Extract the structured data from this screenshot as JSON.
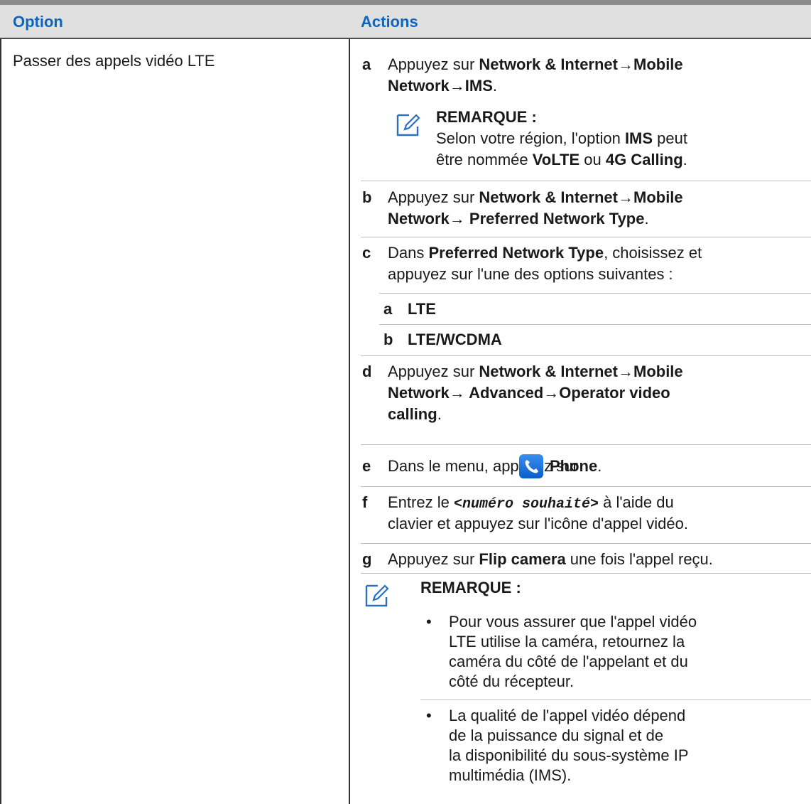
{
  "header": {
    "col_option": "Option",
    "col_actions": "Actions"
  },
  "row": {
    "option": "Passer des appels vidéo LTE",
    "steps": {
      "a": {
        "letter": "a",
        "prefix": "Appuyez sur ",
        "path_1": "Network & Internet→Mobile",
        "path_2": "Network→IMS",
        "end": "."
      },
      "note1": {
        "title": "REMARQUE :",
        "line1_text": "Selon votre région, l'option ",
        "line1_bold": "IMS",
        "line1_end": " peut",
        "line2_pre": "être nommée ",
        "line2_b1": "VoLTE",
        "line2_mid": " ou ",
        "line2_b2": "4G Calling",
        "line2_end": "."
      },
      "b": {
        "letter": "b",
        "prefix": "Appuyez sur ",
        "path_1": "Network & Internet→Mobile",
        "path_2": "Network→ Preferred Network Type",
        "end": "."
      },
      "c": {
        "letter": "c",
        "line1_pre": "Dans ",
        "line1_bold": "Preferred Network Type",
        "line1_end": ", choisissez et",
        "line2": "appuyez sur l'une des options suivantes :",
        "sub": [
          {
            "letter": "a",
            "label": "LTE"
          },
          {
            "letter": "b",
            "label": "LTE/WCDMA"
          }
        ]
      },
      "d": {
        "letter": "d",
        "prefix": "Appuyez sur ",
        "path_1": "Network & Internet→Mobile",
        "path_2": "Network→ Advanced→Operator video",
        "path_3": "calling",
        "end": "."
      },
      "e": {
        "letter": "e",
        "text": "Dans le menu, appuyez sur ",
        "bold": "Phone",
        "end": "."
      },
      "f": {
        "letter": "f",
        "pre": "Entrez le ",
        "mono": "<numéro souhaité>",
        "post": " à l'aide du",
        "line2": "clavier et appuyez sur l'icône d'appel vidéo."
      },
      "g": {
        "letter": "g",
        "pre": "Appuyez sur ",
        "bold": "Flip camera",
        "post": " une fois l'appel reçu."
      },
      "note2": {
        "title": "REMARQUE :",
        "bullet_char": "•",
        "bullet1": [
          "Pour vous assurer que l'appel vidéo",
          "LTE utilise la caméra, retournez la",
          "caméra du côté de l'appelant et du",
          "côté du récepteur."
        ],
        "bullet2": [
          "La qualité de l'appel vidéo dépend",
          "de la puissance du signal et de",
          "la disponibilité du sous-système IP",
          "multimédia (IMS)."
        ]
      }
    }
  },
  "icons": {
    "note": "note-pencil-icon",
    "phone": "phone-app-icon"
  },
  "colors": {
    "header_text": "#0a66c2",
    "header_bg": "#e0e0e0",
    "phone_icon": "#1a73e8"
  }
}
